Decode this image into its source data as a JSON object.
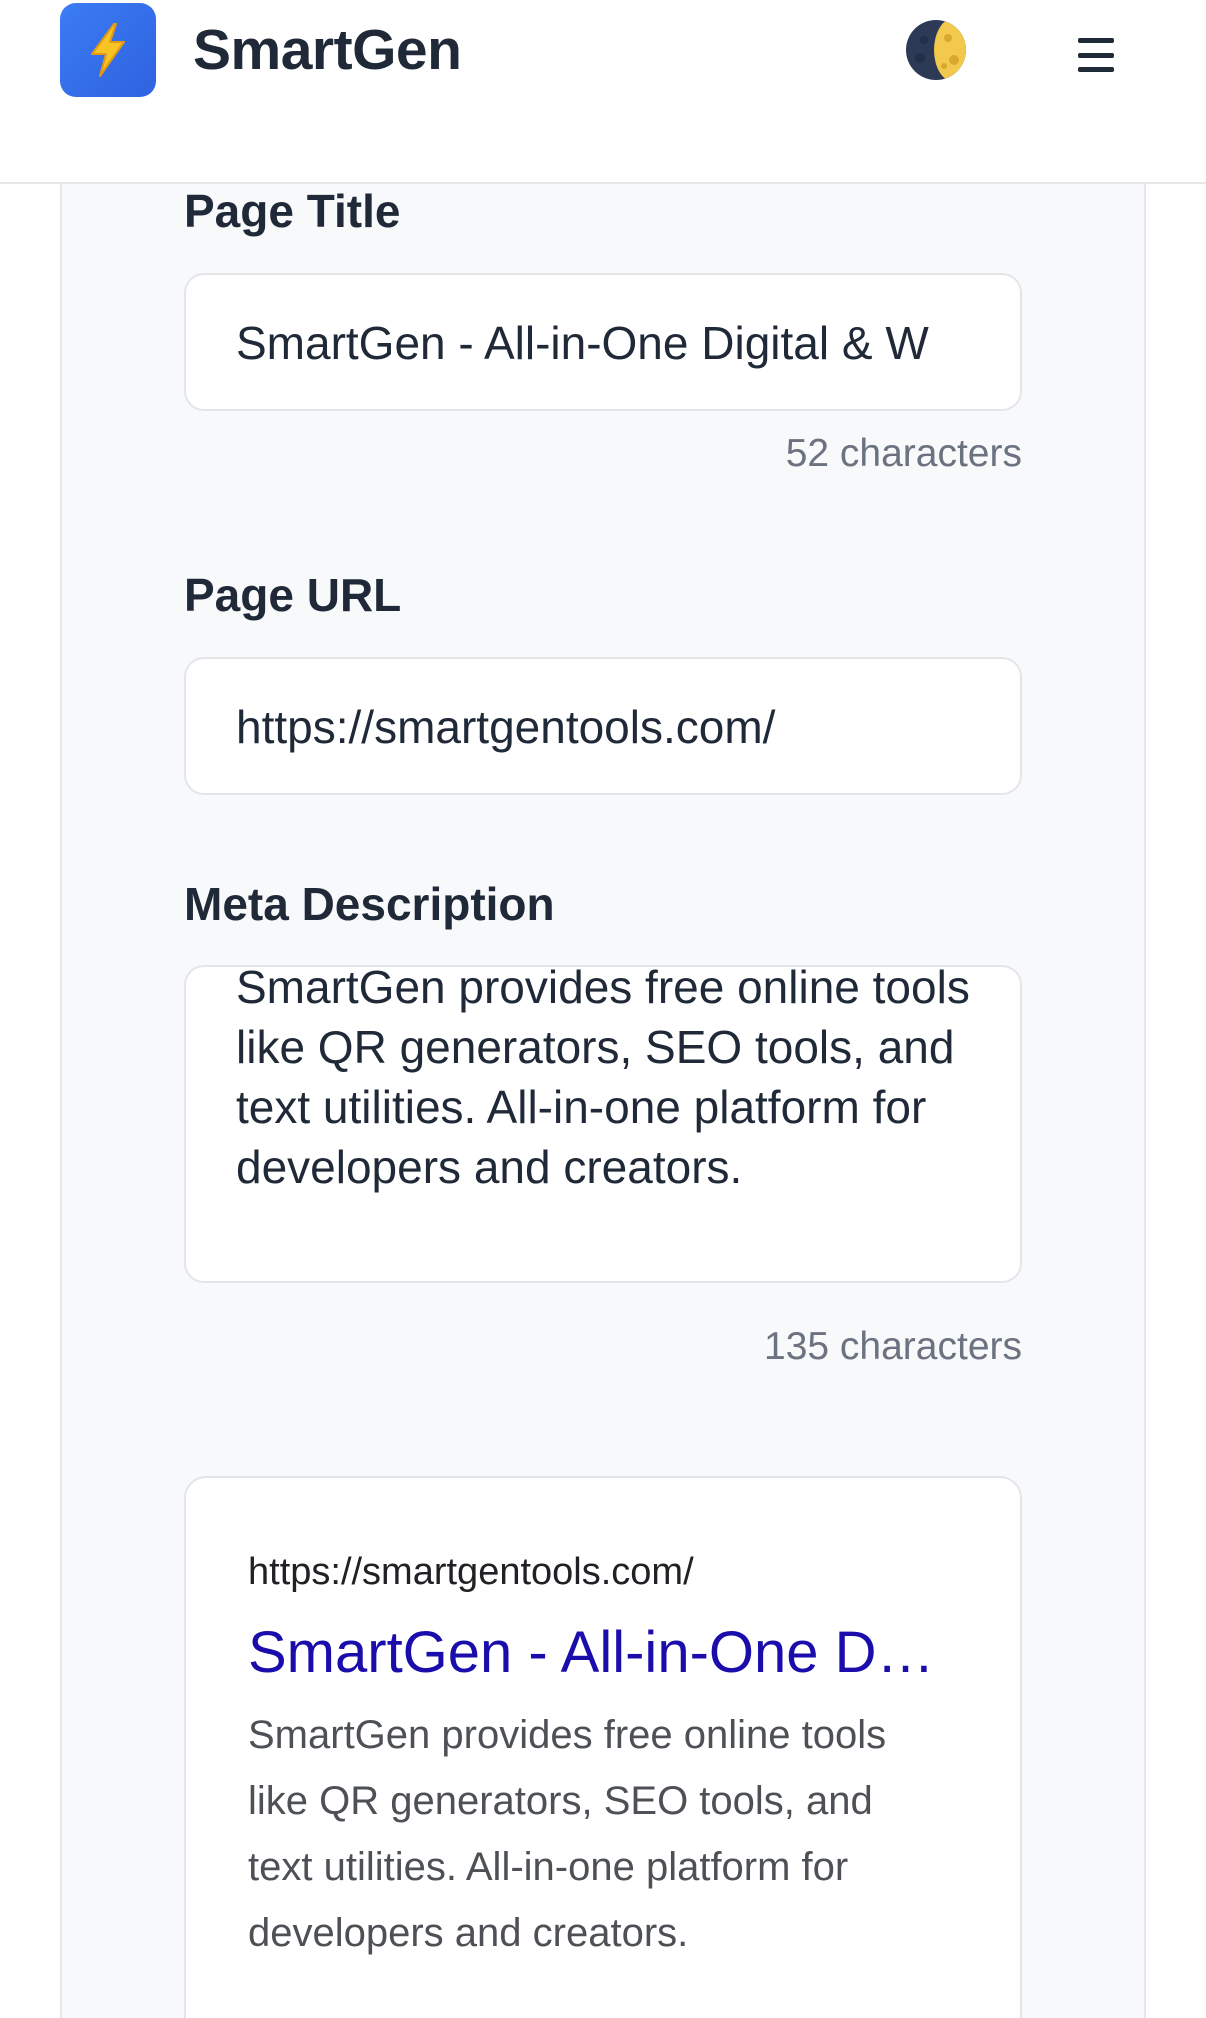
{
  "header": {
    "brand": "SmartGen",
    "logo_icon": "lightning-bolt-icon",
    "theme_icon": "moon-icon",
    "menu_icon": "hamburger-menu-icon"
  },
  "form": {
    "title": {
      "label": "Page Title",
      "value": "SmartGen - All-in-One Digital & W",
      "counter": "52 characters"
    },
    "url": {
      "label": "Page URL",
      "value": "https://smartgentools.com/"
    },
    "description": {
      "label": "Meta Description",
      "value": "SmartGen provides free online tools like QR generators, SEO tools, and text utilities. All-in-one platform for developers and creators.",
      "counter": "135 characters"
    }
  },
  "preview": {
    "url": "https://smartgentools.com/",
    "title": "SmartGen - All-in-One D…",
    "description": "SmartGen provides free online tools like QR generators, SEO tools, and text utilities. All-in-one platform for developers and creators."
  },
  "colors": {
    "brand_blue": "#3b7cf4",
    "serp_link": "#1a0dab",
    "muted_text": "#6b7280"
  }
}
